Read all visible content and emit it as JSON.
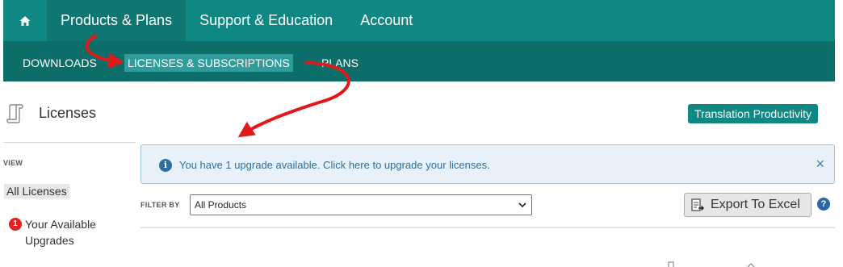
{
  "top_nav": {
    "home_icon": "home-icon",
    "tabs": [
      {
        "label": "Products & Plans",
        "active": true
      },
      {
        "label": "Support & Education",
        "active": false
      },
      {
        "label": "Account",
        "active": false
      }
    ]
  },
  "sub_nav": {
    "items": [
      {
        "label": "DOWNLOADS",
        "active": false
      },
      {
        "label": "LICENSES & SUBSCRIPTIONS",
        "active": true
      },
      {
        "label": "PLANS",
        "active": false
      }
    ]
  },
  "header": {
    "icon": "scroll-icon",
    "title": "Licenses",
    "badge": "Translation Productivity"
  },
  "sidebar": {
    "view_label": "VIEW",
    "items": [
      {
        "label": "All Licenses",
        "selected": true
      },
      {
        "label": "Your Available Upgrades",
        "count": "1"
      }
    ]
  },
  "alert": {
    "icon": "info-icon",
    "text": "You have 1 upgrade available.  Click here to upgrade your licenses.",
    "close": "×"
  },
  "filter": {
    "label": "FILTER BY",
    "selected": "All Products"
  },
  "export": {
    "label": "Export To Excel",
    "icon": "excel-export-icon"
  },
  "help": {
    "label": "?"
  },
  "colors": {
    "nav": "#0f8783",
    "subnav": "#0d6e69",
    "annotation_arrow": "#e01a1a",
    "alert_bg": "#e8f1f9",
    "badge_red": "#e02222"
  }
}
